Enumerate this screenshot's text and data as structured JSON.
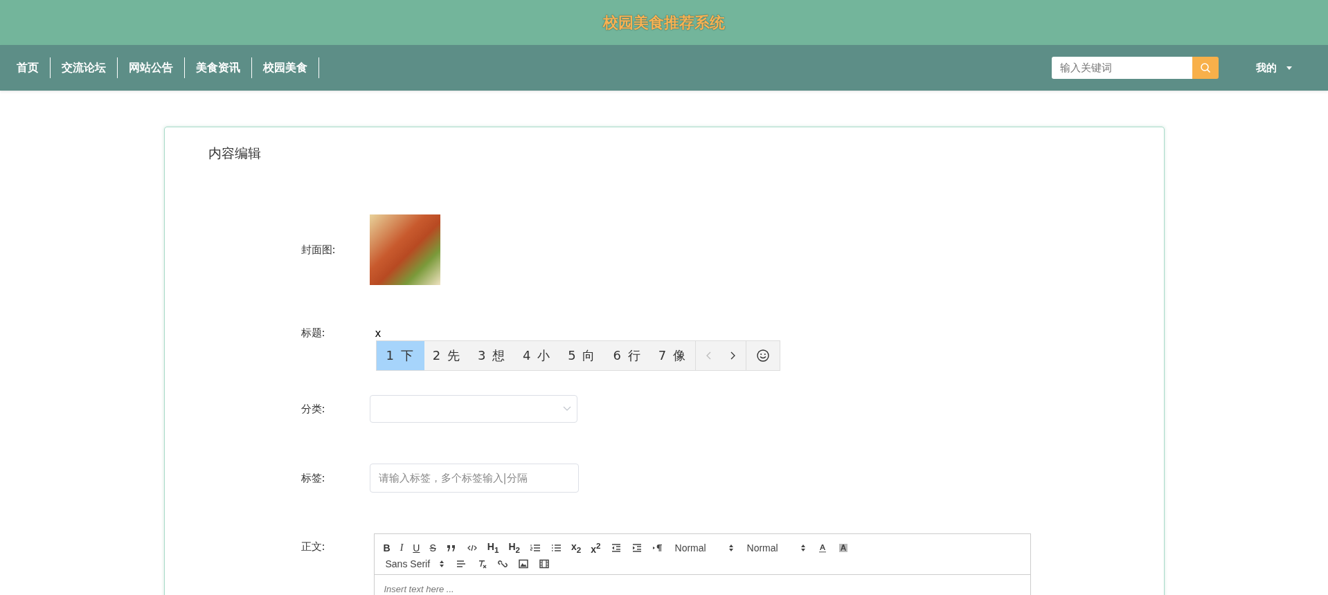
{
  "header": {
    "title": "校园美食推荐系统"
  },
  "nav": {
    "items": [
      {
        "label": "首页"
      },
      {
        "label": "交流论坛"
      },
      {
        "label": "网站公告"
      },
      {
        "label": "美食资讯"
      },
      {
        "label": "校园美食"
      }
    ],
    "search": {
      "placeholder": "输入关键词"
    },
    "user_menu": {
      "label": "我的"
    }
  },
  "card": {
    "title": "内容编辑",
    "cover": {
      "label": "封面图:"
    },
    "title_field": {
      "label": "标题:",
      "value": "x"
    },
    "ime": {
      "candidates": [
        {
          "label": "1 下",
          "selected": true
        },
        {
          "label": "2 先",
          "selected": false
        },
        {
          "label": "3 想",
          "selected": false
        },
        {
          "label": "4 小",
          "selected": false
        },
        {
          "label": "5 向",
          "selected": false
        },
        {
          "label": "6 行",
          "selected": false
        },
        {
          "label": "7 像",
          "selected": false
        }
      ],
      "prev": {
        "disabled": true
      },
      "next": {
        "disabled": false
      }
    },
    "category": {
      "label": "分类:"
    },
    "tags": {
      "label": "标签:",
      "placeholder": "请输入标签，多个标签输入|分隔"
    },
    "body": {
      "label": "正文:",
      "placeholder": "Insert text here ...",
      "toolbar": [
        [
          {
            "kind": "glyph",
            "label": "B"
          },
          {
            "kind": "glyph",
            "label": "I"
          },
          {
            "kind": "glyph",
            "label": "U"
          },
          {
            "kind": "glyph",
            "label": "S"
          },
          {
            "kind": "icon"
          },
          {
            "kind": "icon"
          },
          {
            "kind": "glyph",
            "label": "H$_{1}$"
          },
          {
            "kind": "glyph",
            "label": "H$_{2}$"
          },
          {
            "kind": "icon"
          },
          {
            "kind": "icon"
          },
          {
            "kind": "glyph",
            "label": "x$_{2}$"
          },
          {
            "kind": "glyph",
            "label": "x$^{2}$"
          },
          {
            "kind": "icon"
          },
          {
            "kind": "icon"
          },
          {
            "kind": "icon"
          },
          {
            "kind": "picker",
            "label": "Normal"
          },
          {
            "kind": "picker",
            "label": "Normal"
          },
          {
            "kind": "icon"
          },
          {
            "kind": "icon"
          }
        ],
        [
          {
            "kind": "picker",
            "label": "Sans Serif"
          },
          {
            "kind": "icon"
          },
          {
            "kind": "icon"
          },
          {
            "kind": "icon"
          },
          {
            "kind": "icon"
          },
          {
            "kind": "icon"
          }
        ]
      ]
    }
  }
}
